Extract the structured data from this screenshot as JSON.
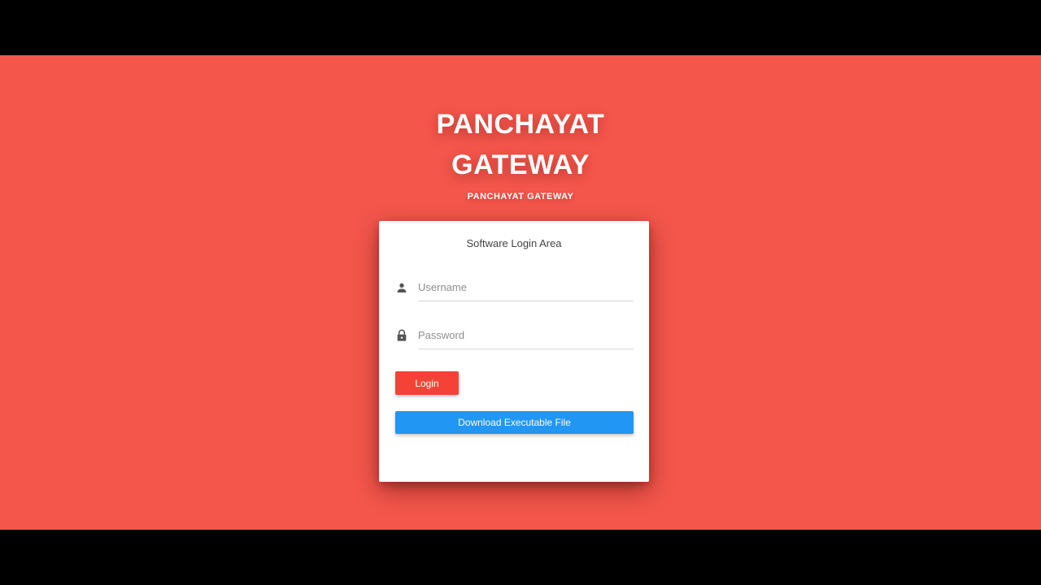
{
  "header": {
    "title_line1": "PANCHAYAT",
    "title_line2": "GATEWAY",
    "subtitle": "PANCHAYAT GATEWAY"
  },
  "login_card": {
    "heading": "Software Login Area",
    "username": {
      "placeholder": "Username",
      "value": "",
      "icon": "person-icon"
    },
    "password": {
      "placeholder": "Password",
      "value": "",
      "icon": "lock-icon"
    },
    "login_button_label": "Login",
    "download_button_label": "Download Executable File"
  },
  "colors": {
    "page_background": "#f4564b",
    "login_button": "#f44336",
    "download_button": "#2196f3",
    "card_background": "#ffffff"
  }
}
